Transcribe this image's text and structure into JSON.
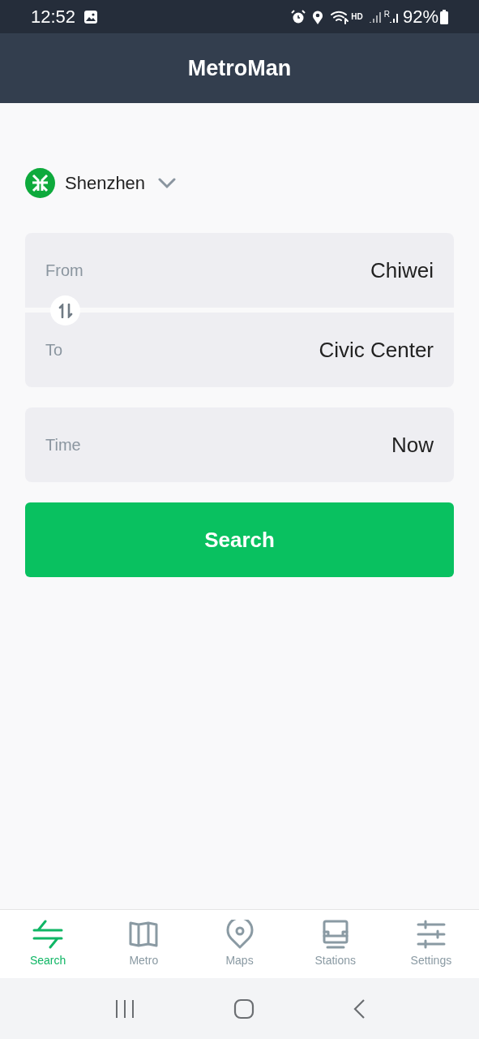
{
  "status_bar": {
    "time": "12:52",
    "network": "HD",
    "roaming": "R",
    "battery": "92%"
  },
  "header": {
    "title": "MetroMan"
  },
  "city": {
    "name": "Shenzhen"
  },
  "route": {
    "from_label": "From",
    "from_value": "Chiwei",
    "to_label": "To",
    "to_value": "Civic Center"
  },
  "time": {
    "label": "Time",
    "value": "Now"
  },
  "search_button": "Search",
  "tabs": [
    {
      "kind": "search",
      "label": "Search",
      "selected": true
    },
    {
      "kind": "metro",
      "label": "Metro",
      "selected": false
    },
    {
      "kind": "maps",
      "label": "Maps",
      "selected": false
    },
    {
      "kind": "stations",
      "label": "Stations",
      "selected": false
    },
    {
      "kind": "settings",
      "label": "Settings",
      "selected": false
    }
  ]
}
